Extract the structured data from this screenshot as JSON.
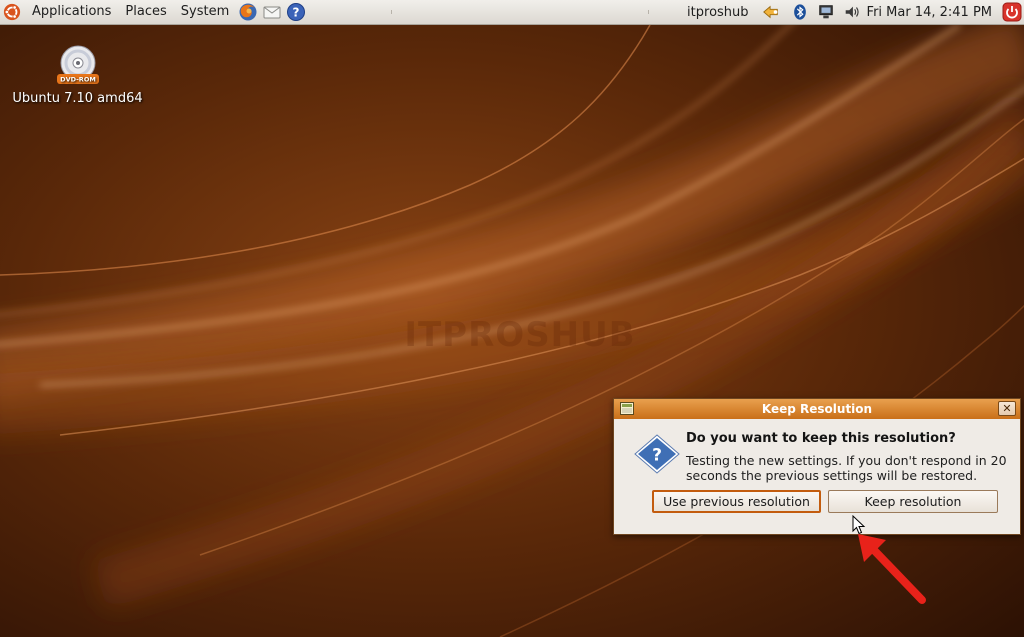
{
  "top_panel": {
    "menus": [
      "Applications",
      "Places",
      "System"
    ],
    "launchers": [
      "firefox-icon",
      "mail-icon",
      "help-icon"
    ],
    "user": "itproshub",
    "clock": "Fri Mar 14,  2:41 PM",
    "tray_icons": [
      "update-icon",
      "bluetooth-icon",
      "network-icon",
      "volume-icon",
      "power-icon"
    ]
  },
  "desktop": {
    "icon_badge": "DVD-ROM",
    "icon_label": "Ubuntu 7.10 amd64",
    "watermark": "ITPROSHUB"
  },
  "dialog": {
    "title": "Keep Resolution",
    "close_glyph": "✕",
    "heading": "Do you want to keep this resolution?",
    "body": "Testing the new settings. If you don't respond in 20 seconds the previous settings will be restored.",
    "buttons": {
      "previous": "Use previous resolution",
      "keep": "Keep resolution"
    }
  },
  "colors": {
    "panel": "#dcd8d1",
    "titlebar": "#d67e22",
    "dialog_bg": "#efebe6",
    "annotation_arrow": "#e8221a"
  }
}
